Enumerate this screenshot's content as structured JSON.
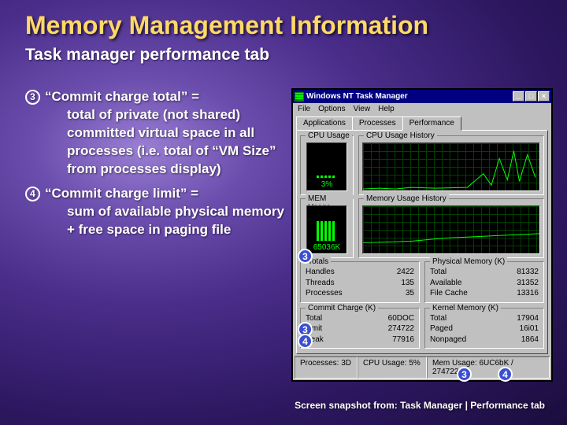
{
  "slide": {
    "title": "Memory Management Information",
    "subtitle": "Task manager performance tab",
    "bullet3_head": "“Commit charge total” =",
    "bullet3_body": "total of private (not shared) committed virtual space in all processes (i.e. total of “VM Size” from processes display)",
    "bullet4_head": "“Commit charge limit” =",
    "bullet4_body": "sum of available physical memory + free space in paging file",
    "footnote": "Screen snapshot from: Task Manager | Performance tab",
    "marker3": "3",
    "marker4": "4"
  },
  "tm": {
    "title": "Windows NT Task Manager",
    "minimize_icon": "_",
    "maximize_icon": "□",
    "close_icon": "×",
    "menu": {
      "file": "File",
      "options": "Options",
      "view": "View",
      "help": "Help"
    },
    "tabs": {
      "applications": "Applications",
      "processes": "Processes",
      "performance": "Performance"
    },
    "cpu_usage_label": "CPU Usage",
    "cpu_usage_value": "3%",
    "cpu_history_label": "CPU Usage History",
    "mem_usage_label": "MEM Usage",
    "mem_usage_value": "65036K",
    "mem_history_label": "Memory Usage History",
    "totals": {
      "label": "Totals",
      "handles_label": "Handles",
      "handles_value": "2422",
      "threads_label": "Threads",
      "threads_value": "135",
      "processes_label": "Processes",
      "processes_value": "35"
    },
    "commit": {
      "label": "Commit Charge (K)",
      "total_label": "Total",
      "total_value": "60DOC",
      "limit_label": "Limit",
      "limit_value": "274722",
      "peak_label": "Peak",
      "peak_value": "77916"
    },
    "physmem": {
      "label": "Physical Memory (K)",
      "total_label": "Total",
      "total_value": "81332",
      "available_label": "Available",
      "available_value": "31352",
      "filecache_label": "File Cache",
      "filecache_value": "13316"
    },
    "kernel": {
      "label": "Kernel Memory (K)",
      "total_label": "Total",
      "total_value": "17904",
      "paged_label": "Paged",
      "paged_value": "16i01",
      "nonpaged_label": "Nonpaged",
      "nonpaged_value": "1864"
    },
    "status": {
      "processes": "Processes: 3D",
      "cpu": "CPU Usage: 5%",
      "mem": "Mem Usage: 6UC6bK / 274722K"
    }
  }
}
